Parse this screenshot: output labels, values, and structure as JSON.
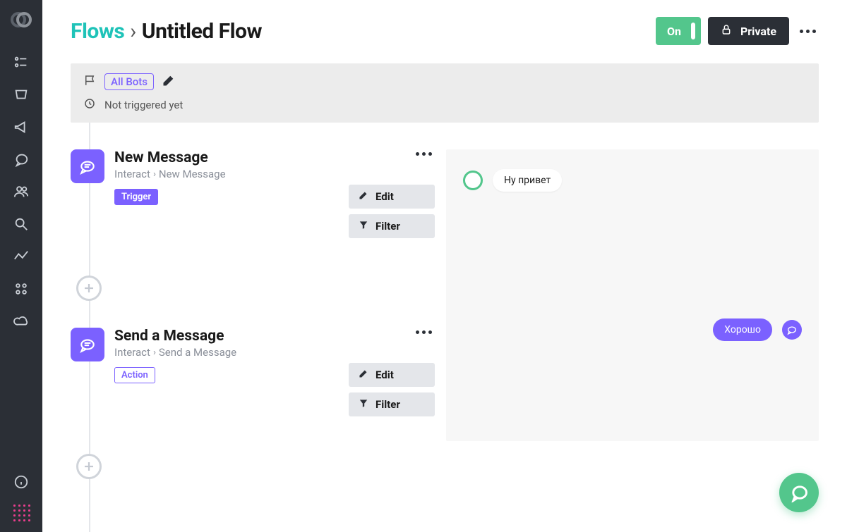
{
  "breadcrumb": {
    "root": "Flows",
    "separator": "›",
    "current": "Untitled Flow"
  },
  "header": {
    "toggle_label": "On",
    "private_label": "Private"
  },
  "info_bar": {
    "bots_label": "All Bots",
    "trigger_status": "Not triggered yet"
  },
  "steps": [
    {
      "title": "New Message",
      "path_root": "Interact",
      "path_leaf": "New Message",
      "tag": "Trigger",
      "tag_type": "trigger",
      "edit_label": "Edit",
      "filter_label": "Filter"
    },
    {
      "title": "Send a Message",
      "path_root": "Interact",
      "path_leaf": "Send a Message",
      "tag": "Action",
      "tag_type": "action",
      "edit_label": "Edit",
      "filter_label": "Filter"
    }
  ],
  "chat": {
    "incoming": "Ну привет",
    "outgoing": "Хорошо"
  }
}
